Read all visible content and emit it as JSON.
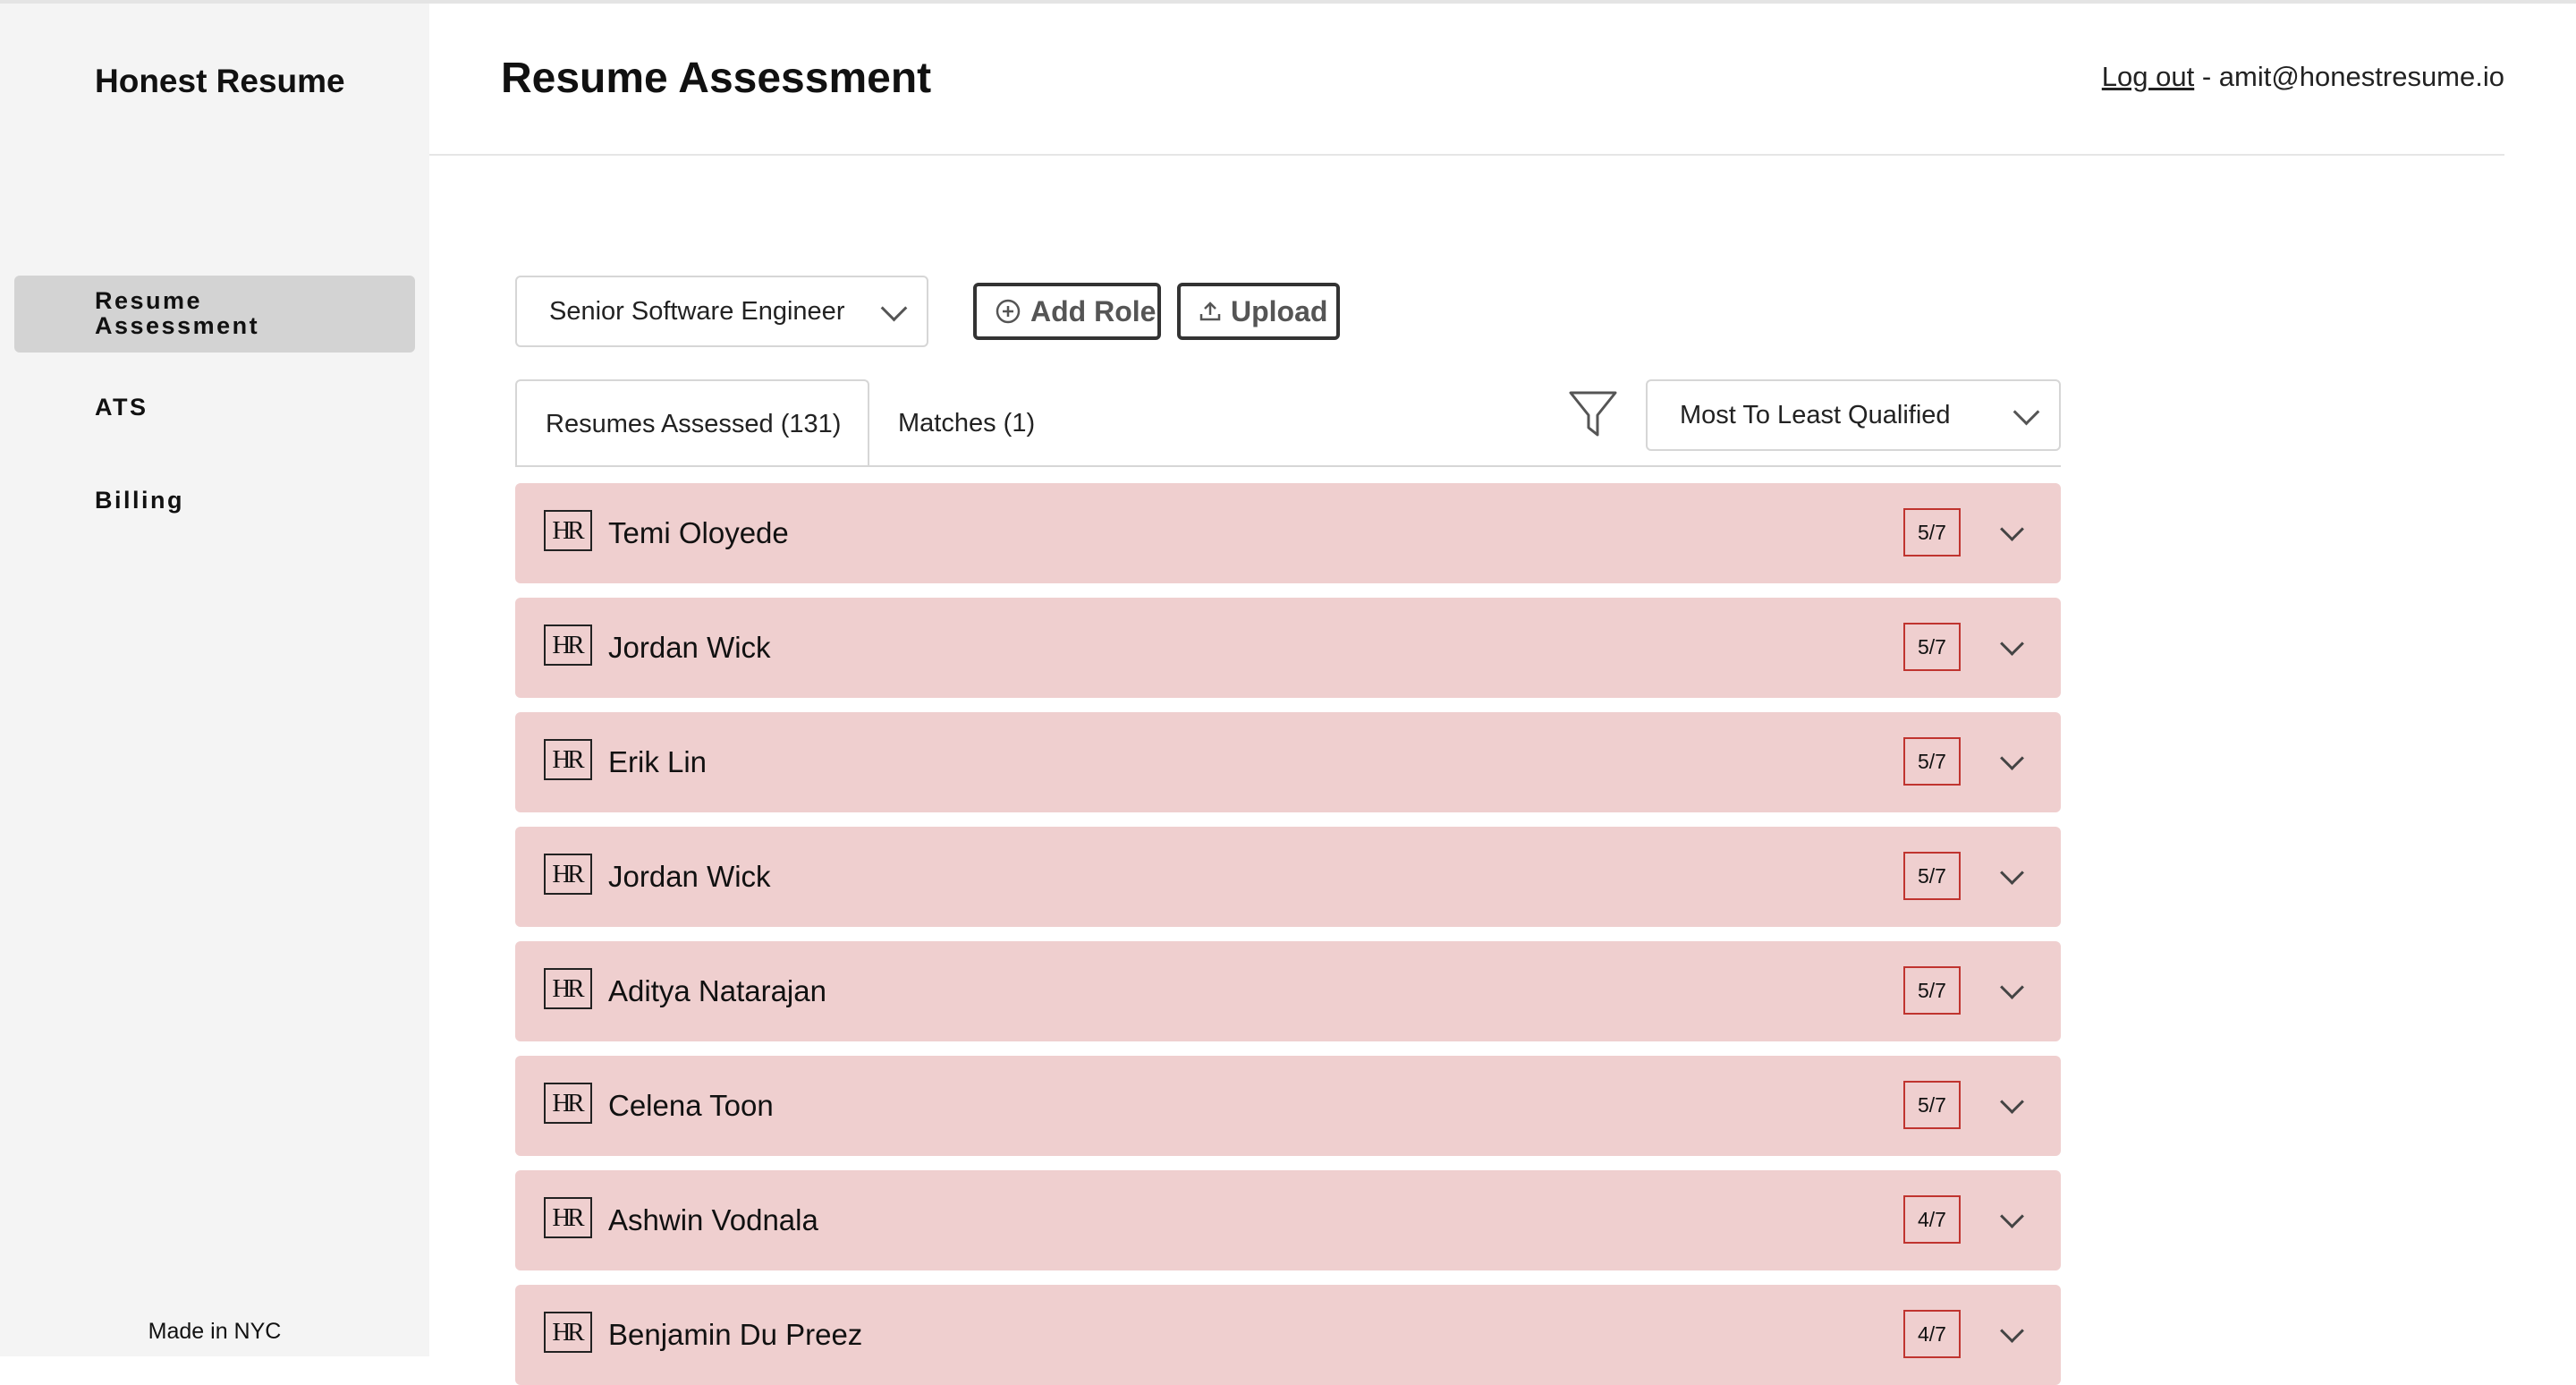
{
  "app": {
    "brand": "Honest Resume",
    "footer": "Made in NYC"
  },
  "sidebar": {
    "items": [
      {
        "label": "Resume Assessment",
        "active": true
      },
      {
        "label": "ATS",
        "active": false
      },
      {
        "label": "Billing",
        "active": false
      }
    ]
  },
  "header": {
    "title": "Resume Assessment",
    "logout_label": "Log out",
    "user_email": " - amit@honestresume.io"
  },
  "toolbar": {
    "role_selected": "Senior Software Engineer",
    "add_role_label": "Add Role",
    "upload_label": "Upload"
  },
  "tabs": [
    {
      "label": "Resumes Assessed (131)",
      "active": true
    },
    {
      "label": "Matches (1)",
      "active": false
    }
  ],
  "sort": {
    "selected": "Most To Least Qualified"
  },
  "candidates": [
    {
      "logo": "HR",
      "name": "Temi Oloyede",
      "score": "5/7"
    },
    {
      "logo": "HR",
      "name": "Jordan Wick",
      "score": "5/7"
    },
    {
      "logo": "HR",
      "name": "Erik Lin",
      "score": "5/7"
    },
    {
      "logo": "HR",
      "name": "Jordan Wick",
      "score": "5/7"
    },
    {
      "logo": "HR",
      "name": "Aditya Natarajan",
      "score": "5/7"
    },
    {
      "logo": "HR",
      "name": "Celena Toon",
      "score": "5/7"
    },
    {
      "logo": "HR",
      "name": "Ashwin Vodnala",
      "score": "4/7"
    },
    {
      "logo": "HR",
      "name": "Benjamin Du Preez",
      "score": "4/7"
    }
  ],
  "colors": {
    "row_background": "#efcfcf",
    "score_border": "#c0342f",
    "sidebar_background": "#f4f4f4",
    "active_nav": "#d3d3d3"
  }
}
